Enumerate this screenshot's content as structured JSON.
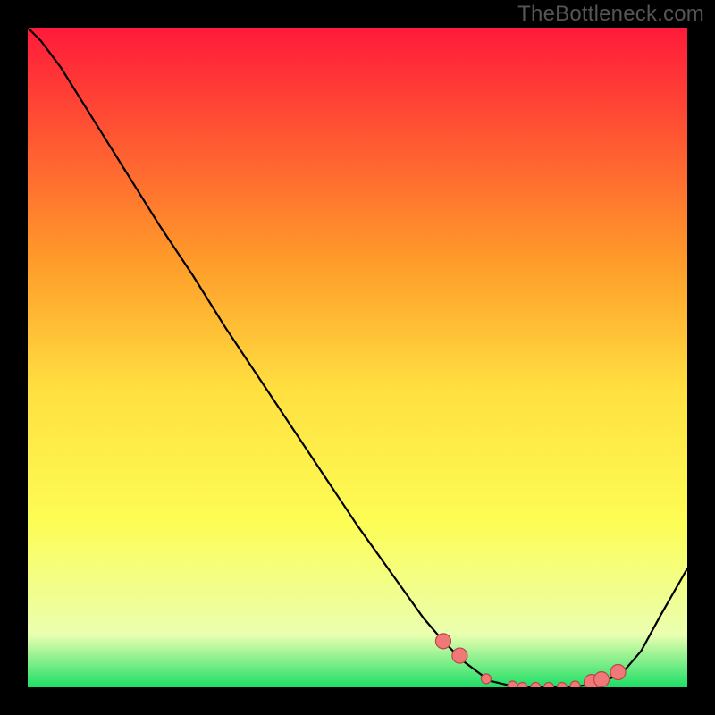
{
  "watermark": "TheBottleneck.com",
  "colors": {
    "bg_black": "#000000",
    "curve": "#000000",
    "marker_fill": "#f07878",
    "marker_stroke": "#b84848",
    "grad_top": "#ff1a3a",
    "grad_mid1": "#ff9a2a",
    "grad_mid2": "#ffe040",
    "grad_mid3": "#fdfd55",
    "grad_mid4": "#eaffb0",
    "grad_bottom": "#1ddf66"
  },
  "chart_data": {
    "type": "line",
    "title": "",
    "xlabel": "",
    "ylabel": "",
    "x": [
      0.0,
      0.02,
      0.05,
      0.1,
      0.15,
      0.2,
      0.25,
      0.3,
      0.35,
      0.4,
      0.45,
      0.5,
      0.55,
      0.6,
      0.63,
      0.66,
      0.7,
      0.73,
      0.76,
      0.8,
      0.83,
      0.86,
      0.9,
      0.93,
      0.96,
      1.0
    ],
    "values": [
      1.0,
      0.98,
      0.94,
      0.86,
      0.78,
      0.7,
      0.625,
      0.545,
      0.47,
      0.395,
      0.32,
      0.245,
      0.175,
      0.105,
      0.07,
      0.04,
      0.01,
      0.003,
      0.0,
      0.0,
      0.001,
      0.005,
      0.02,
      0.055,
      0.11,
      0.18
    ],
    "xlim": [
      0,
      1
    ],
    "ylim": [
      0,
      1
    ],
    "markers": {
      "x": [
        0.63,
        0.655,
        0.695,
        0.735,
        0.75,
        0.77,
        0.79,
        0.81,
        0.83,
        0.855,
        0.87,
        0.895
      ],
      "y": [
        0.07,
        0.048,
        0.013,
        0.002,
        0.0,
        0.0,
        0.0,
        0.0,
        0.002,
        0.008,
        0.012,
        0.023
      ],
      "r_large": [
        0.63,
        0.655,
        0.855,
        0.87,
        0.895
      ],
      "r_small": [
        0.695,
        0.735,
        0.75,
        0.77,
        0.79,
        0.81,
        0.83
      ]
    }
  }
}
